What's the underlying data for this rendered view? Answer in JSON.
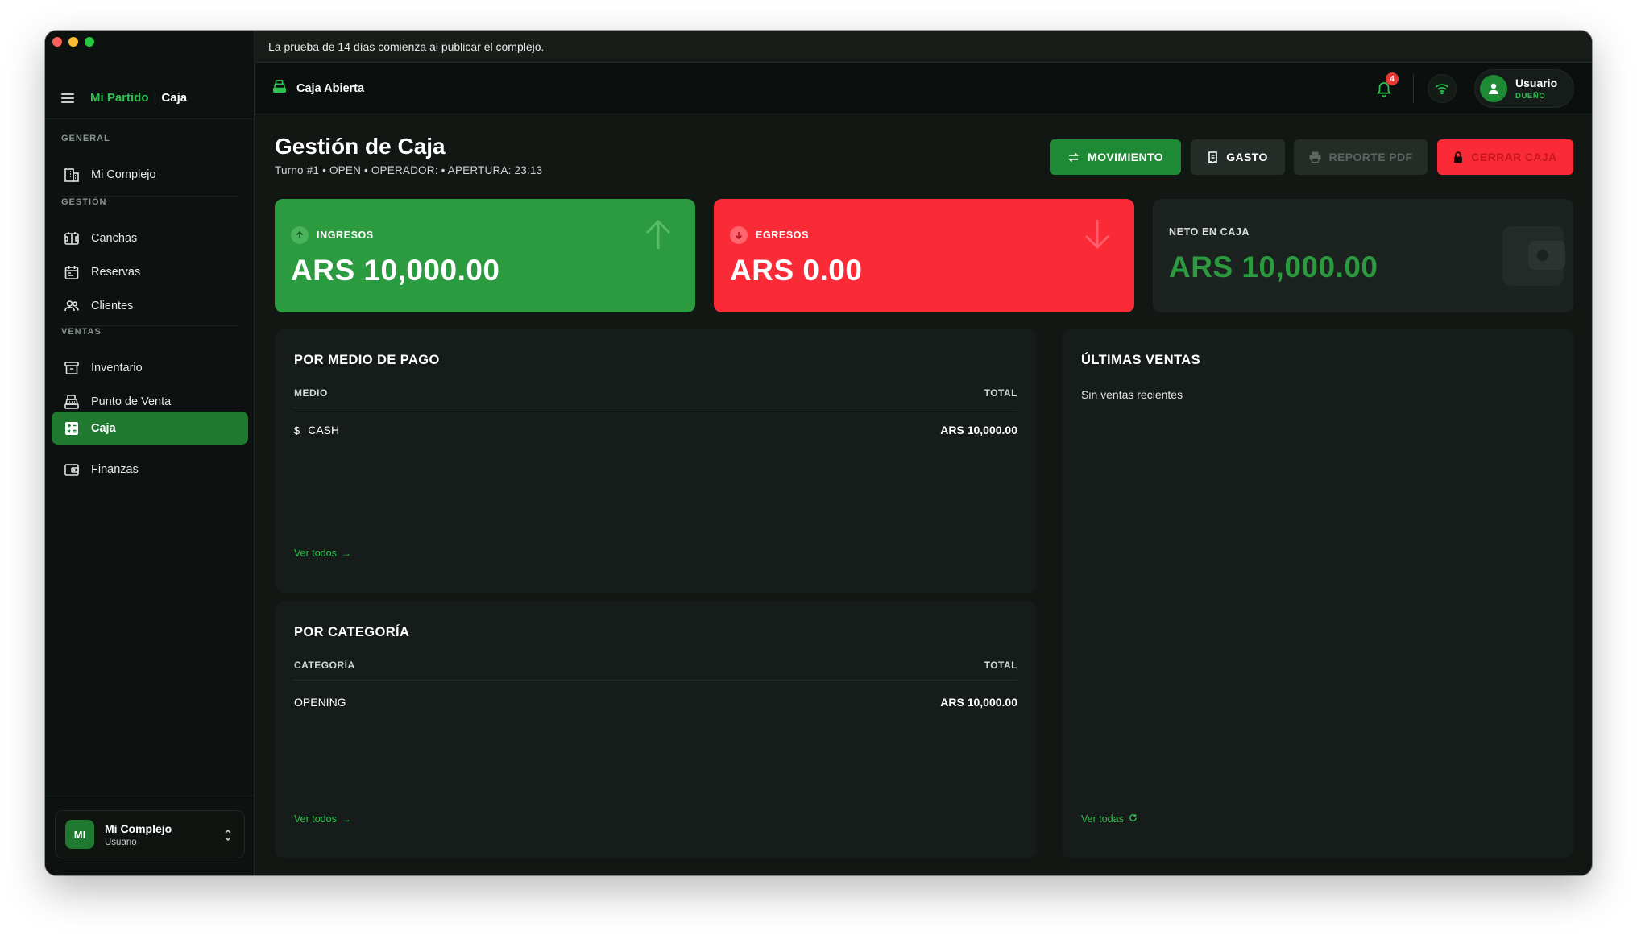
{
  "banner": {
    "text": "La prueba de 14 días comienza al publicar el complejo."
  },
  "sidebar": {
    "brand": "Mi Partido",
    "current_page": "Caja",
    "sections": [
      {
        "label": "GENERAL"
      },
      {
        "label": "GESTIÓN"
      },
      {
        "label": "VENTAS"
      }
    ],
    "items": [
      {
        "label": "Mi Complejo",
        "icon": "building-icon"
      },
      {
        "label": "Canchas",
        "icon": "court-icon"
      },
      {
        "label": "Reservas",
        "icon": "calendar-icon"
      },
      {
        "label": "Clientes",
        "icon": "users-icon"
      },
      {
        "label": "Inventario",
        "icon": "archive-icon"
      },
      {
        "label": "Punto de Venta",
        "icon": "cash-register-icon"
      },
      {
        "label": "Caja",
        "icon": "calculator-icon",
        "active": true
      },
      {
        "label": "Finanzas",
        "icon": "wallet-icon"
      }
    ],
    "complex": {
      "initials": "MI",
      "name": "Mi Complejo",
      "role": "Usuario"
    }
  },
  "header": {
    "title": "Caja Abierta",
    "notifications_count": "4",
    "user": {
      "name": "Usuario",
      "role": "DUEÑO"
    }
  },
  "page": {
    "title": "Gestión de Caja",
    "subtitle": "Turno #1 • OPEN • OPERADOR:  • APERTURA: 23:13"
  },
  "actions": {
    "movimiento": "MOVIMIENTO",
    "gasto": "GASTO",
    "reporte_pdf": "REPORTE PDF",
    "cerrar_caja": "CERRAR CAJA"
  },
  "kpis": {
    "ingresos": {
      "label": "INGRESOS",
      "value": "ARS 10,000.00"
    },
    "egresos": {
      "label": "EGRESOS",
      "value": "ARS 0.00"
    },
    "neto": {
      "label": "NETO EN CAJA",
      "value": "ARS 10,000.00"
    }
  },
  "payment_methods": {
    "title": "POR MEDIO DE PAGO",
    "col_left": "MEDIO",
    "col_right": "TOTAL",
    "rows": [
      {
        "label": "CASH",
        "total": "ARS 10,000.00"
      }
    ],
    "link": "Ver todos"
  },
  "categories": {
    "title": "POR CATEGORÍA",
    "col_left": "CATEGORÍA",
    "col_right": "TOTAL",
    "rows": [
      {
        "label": "OPENING",
        "total": "ARS 10,000.00"
      }
    ],
    "link": "Ver todos"
  },
  "recent_sales": {
    "title": "ÚLTIMAS VENTAS",
    "empty": "Sin ventas recientes",
    "link": "Ver todas"
  },
  "colors": {
    "accent": "#2cc150",
    "income": "#2c9a3f",
    "expense": "#fb2a37",
    "background": "#121714"
  }
}
